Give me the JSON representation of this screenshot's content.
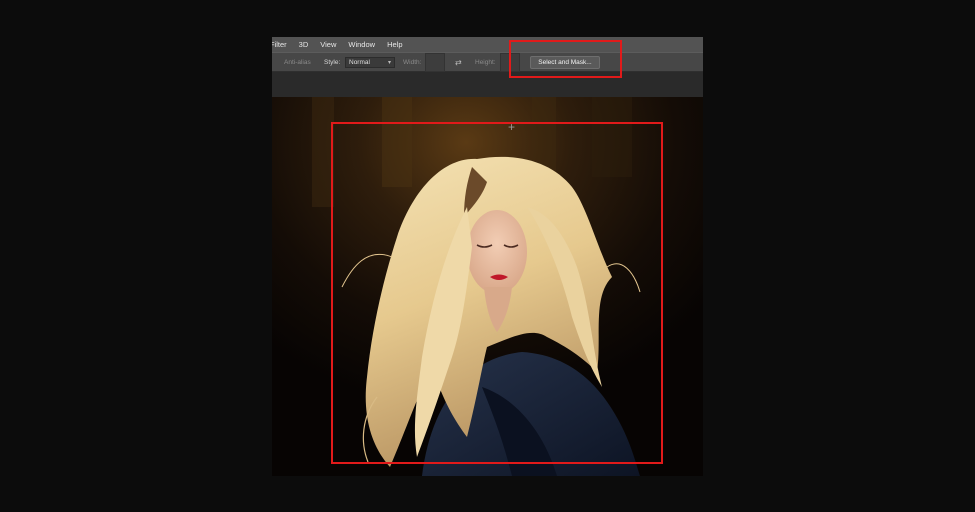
{
  "menubar": {
    "items": [
      "Filter",
      "3D",
      "View",
      "Window",
      "Help"
    ]
  },
  "options": {
    "anti_alias_label": "Anti-alias",
    "style_label": "Style:",
    "style_value": "Normal",
    "width_label": "Width:",
    "height_label": "Height:",
    "swap_icon": "swap-arrows-icon",
    "select_and_mask_label": "Select and Mask..."
  },
  "canvas": {
    "crosshair_icon": "crosshair-cursor-icon"
  },
  "annotation_color": "#e11a1a"
}
